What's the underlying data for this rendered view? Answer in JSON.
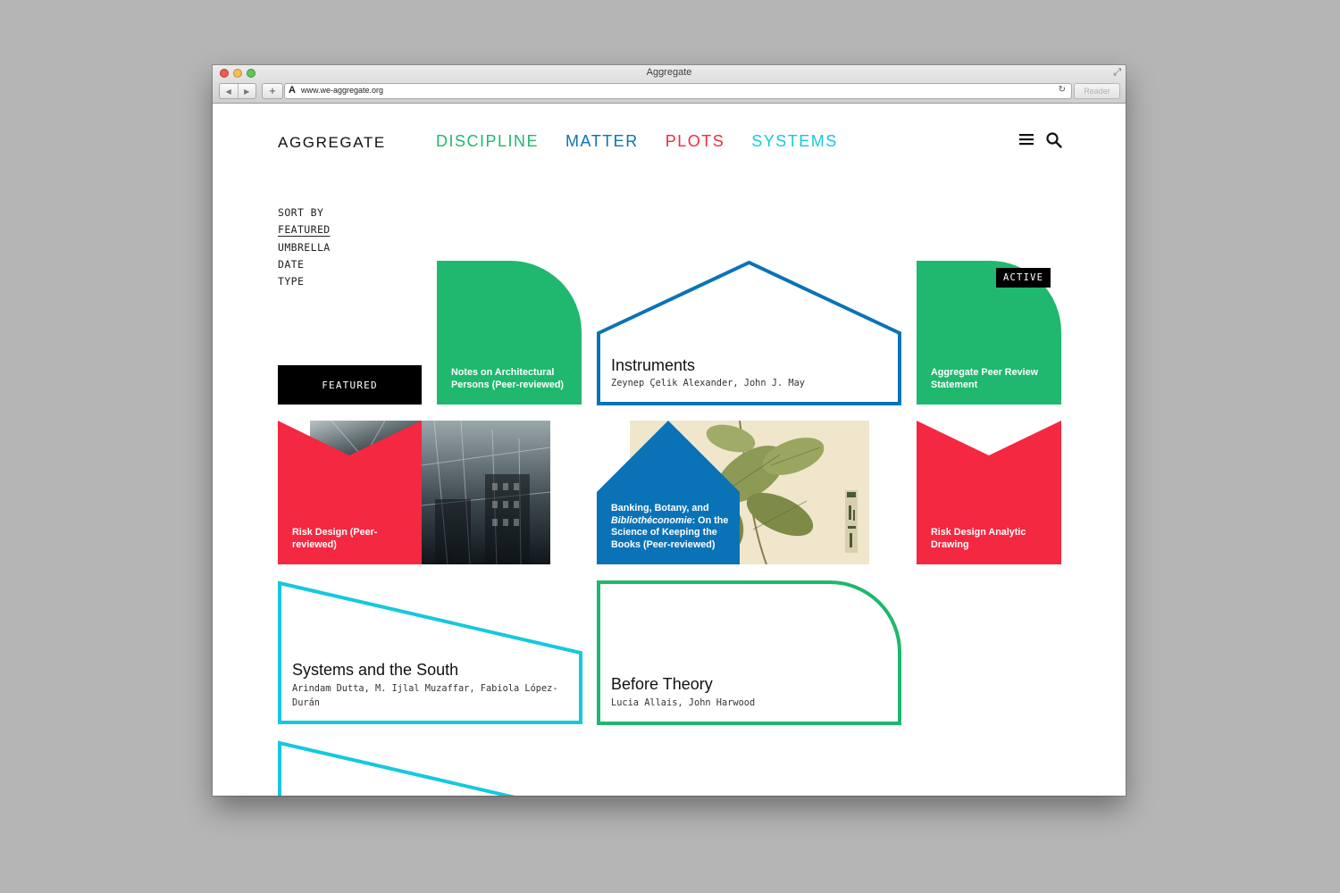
{
  "window": {
    "title": "Aggregate",
    "url": "www.we-aggregate.org",
    "reader_label": "Reader"
  },
  "site": {
    "logo": "AGGREGATE",
    "nav": [
      {
        "label": "DISCIPLINE",
        "color": "#1fb86e"
      },
      {
        "label": "MATTER",
        "color": "#0a73b7"
      },
      {
        "label": "PLOTS",
        "color": "#f42840"
      },
      {
        "label": "SYSTEMS",
        "color": "#16c8de"
      }
    ]
  },
  "sort": {
    "heading": "SORT BY",
    "options": [
      "FEATURED",
      "UMBRELLA",
      "DATE",
      "TYPE"
    ],
    "active": "FEATURED"
  },
  "colors": {
    "discipline": "#1fb86e",
    "matter": "#0a73b7",
    "plots": "#f42840",
    "systems": "#16c8de"
  },
  "tiles": {
    "featured_label": "FEATURED",
    "notes": {
      "label": "Notes on Architectural Persons (Peer-reviewed)"
    },
    "instruments": {
      "title": "Instruments",
      "authors": "Zeynep Çelik Alexander, John J. May"
    },
    "peer_review": {
      "label": "Aggregate Peer Review Statement",
      "badge": "ACTIVE"
    },
    "risk_design": {
      "label": "Risk Design (Peer-reviewed)"
    },
    "banking": {
      "label_pre": "Banking, Botany, and ",
      "label_italic": "Bibliothéconomie",
      "label_post": ": On the Science of Keeping the Books (Peer-reviewed)"
    },
    "risk_drawing": {
      "label": "Risk Design Analytic Drawing"
    },
    "systems_south": {
      "title": "Systems and the South",
      "authors": "Arindam Dutta, M. Ijlal Muzaffar, Fabiola López-Durán"
    },
    "before_theory": {
      "title": "Before Theory",
      "authors": "Lucia Allais, John Harwood"
    }
  }
}
